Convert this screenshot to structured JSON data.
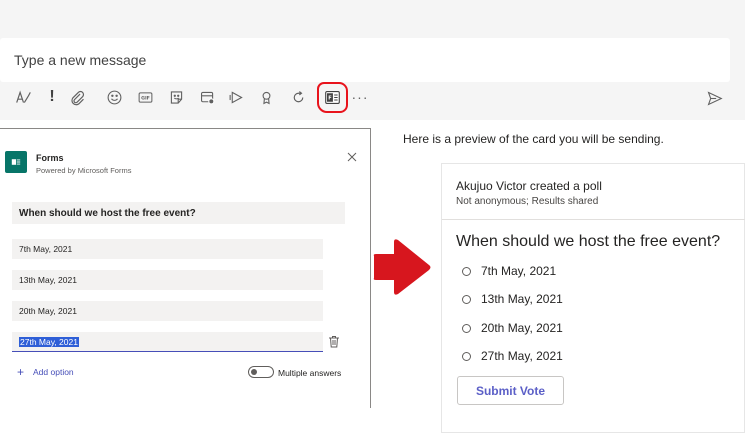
{
  "compose": {
    "placeholder": "Type a new message",
    "toolbar_icons": [
      "format-icon",
      "important-icon",
      "attach-icon",
      "emoji-icon",
      "gif-icon",
      "sticker-icon",
      "meet-now-icon",
      "stream-icon",
      "praise-icon",
      "loop-icon",
      "forms-icon",
      "more-options-icon"
    ],
    "send_icon": "send-icon",
    "highlight_color": "#e8131c"
  },
  "forms_panel": {
    "app_name": "Forms",
    "app_subtitle": "Powered by Microsoft Forms",
    "question": "When should we host the free event?",
    "options": [
      "7th May, 2021",
      "13th May, 2021",
      "20th May, 2021",
      "27th May, 2021"
    ],
    "add_option_label": "Add option",
    "multiple_answers_label": "Multiple answers",
    "multiple_answers_enabled": false,
    "accent": "#464eb8",
    "brand_color": "#077568"
  },
  "arrow_color": "#d7161e",
  "preview": {
    "heading": "Here is a preview of the card you will be sending.",
    "author_line": "Akujuo Victor created a poll",
    "meta_line": "Not anonymous; Results shared",
    "question": "When should we host the free event?",
    "options": [
      "7th May, 2021",
      "13th May, 2021",
      "20th May, 2021",
      "27th May, 2021"
    ],
    "submit_label": "Submit Vote",
    "submit_color": "#5b5fc7"
  }
}
